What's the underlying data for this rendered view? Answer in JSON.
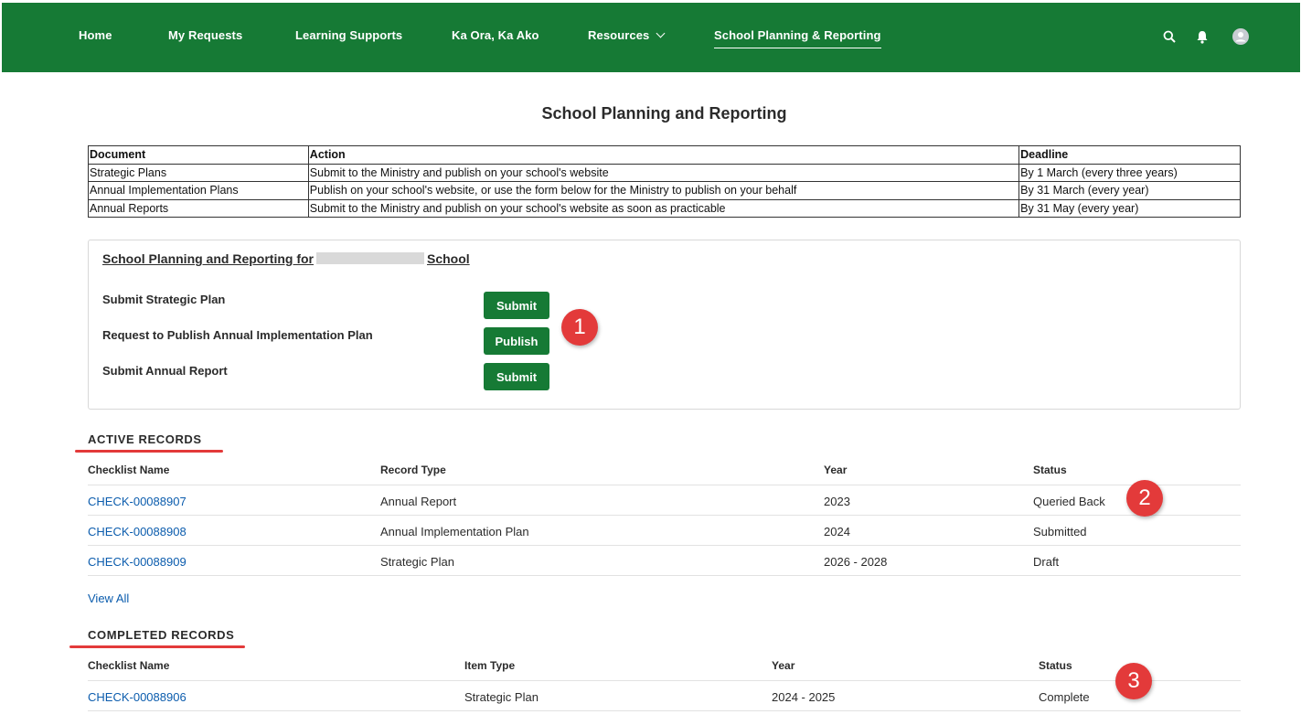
{
  "nav": {
    "items": [
      "Home",
      "My Requests",
      "Learning Supports",
      "Ka Ora, Ka Ako",
      "Resources",
      "School Planning & Reporting"
    ],
    "icons": [
      "search-icon",
      "bell-icon",
      "avatar-icon"
    ],
    "bg_color": "#167a35"
  },
  "page_title": "School Planning and Reporting",
  "info_table": {
    "headers": [
      "Document",
      "Action",
      "Deadline"
    ],
    "rows": [
      [
        "Strategic Plans",
        "Submit to the Ministry and publish on your school's website",
        "By 1 March (every three years)"
      ],
      [
        "Annual Implementation Plans",
        "Publish on your school's website, or use the form below for the Ministry to publish on your behalf",
        "By 31 March (every year)"
      ],
      [
        "Annual Reports",
        "Submit to the Ministry and publish on your school's website as soon as practicable",
        "By 31 May (every year)"
      ]
    ]
  },
  "panel": {
    "heading_prefix": "School Planning and Reporting for",
    "heading_suffix": "School",
    "actions": [
      {
        "label": "Submit Strategic Plan",
        "button": "Submit"
      },
      {
        "label": "Request to Publish Annual Implementation Plan",
        "button": "Publish"
      },
      {
        "label": "Submit Annual Report",
        "button": "Submit"
      }
    ]
  },
  "callouts": [
    "1",
    "2",
    "3"
  ],
  "active_records": {
    "title": "ACTIVE RECORDS",
    "headers": [
      "Checklist Name",
      "Record Type",
      "Year",
      "Status"
    ],
    "rows": [
      [
        "CHECK-00088907",
        "Annual Report",
        "2023",
        "Queried Back"
      ],
      [
        "CHECK-00088908",
        "Annual Implementation Plan",
        "2024",
        "Submitted"
      ],
      [
        "CHECK-00088909",
        "Strategic Plan",
        "2026 - 2028",
        "Draft"
      ]
    ],
    "view_all": "View All"
  },
  "completed_records": {
    "title": "COMPLETED RECORDS",
    "headers": [
      "Checklist Name",
      "Item Type",
      "Year",
      "Status"
    ],
    "rows": [
      [
        "CHECK-00088906",
        "Strategic Plan",
        "2024 - 2025",
        "Complete"
      ]
    ]
  }
}
